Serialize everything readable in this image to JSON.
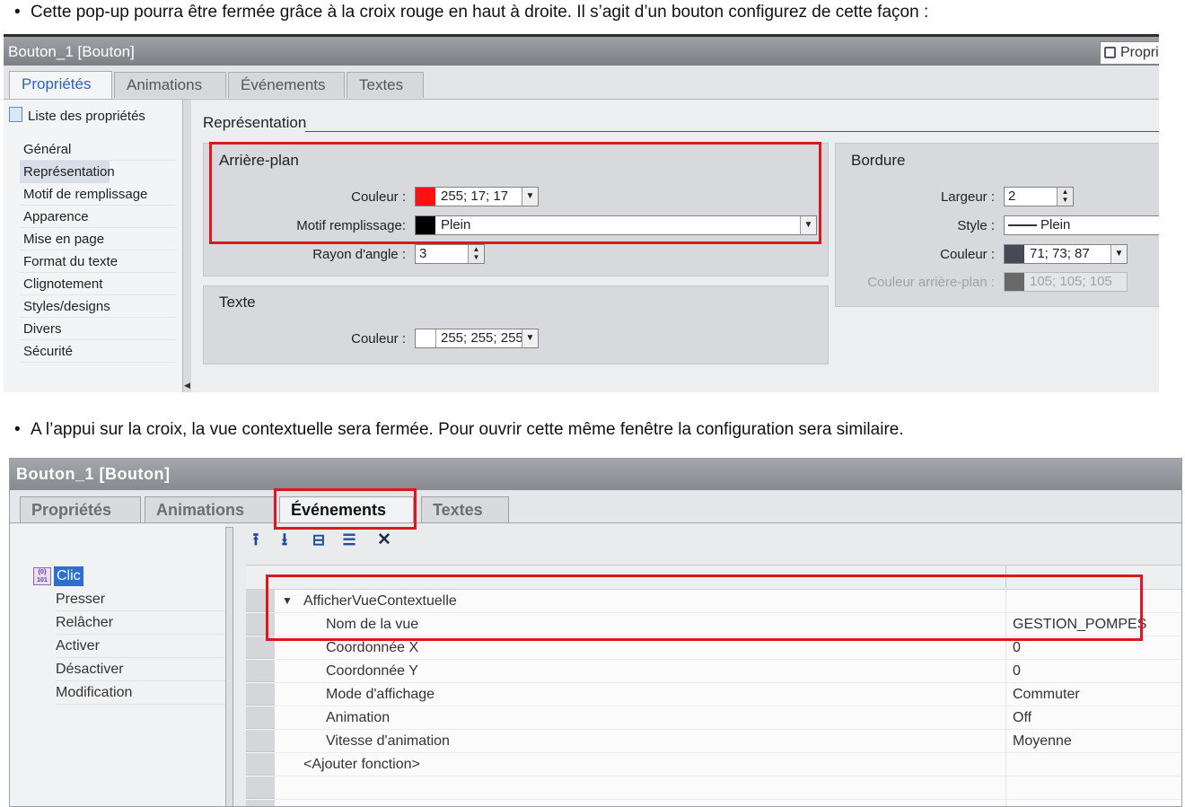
{
  "doc": {
    "bullet_char": "•",
    "bullet1": "Cette pop-up pourra être fermée grâce à la croix rouge en haut à droite. Il s’agit d’un bouton configurez de cette façon :",
    "bullet2": "A l’appui sur la croix, la vue contextuelle sera fermée. Pour ouvrir cette même fenêtre la configuration sera similaire."
  },
  "panel1": {
    "title": "Bouton_1 [Bouton]",
    "propri": "Propri",
    "tabs": [
      "Propriétés",
      "Animations",
      "Événements",
      "Textes"
    ],
    "active_tab": "Propriétés",
    "sidebar_header": "Liste des propriétés",
    "sidebar_items": [
      "Général",
      "Représentation",
      "Motif de remplissage",
      "Apparence",
      "Mise en page",
      "Format du texte",
      "Clignotement",
      "Styles/designs",
      "Divers",
      "Sécurité"
    ],
    "selected_item": "Représentation",
    "section": "Représentation",
    "arriere_plan": {
      "title": "Arrière-plan",
      "couleur_label": "Couleur :",
      "couleur_value": "255; 17; 17",
      "couleur_hex": "#ff1111",
      "motif_label": "Motif remplissage:",
      "motif_value": "Plein",
      "motif_hex": "#000000",
      "rayon_label": "Rayon d'angle :",
      "rayon_value": "3"
    },
    "texte": {
      "title": "Texte",
      "couleur_label": "Couleur :",
      "couleur_value": "255; 255; 255",
      "couleur_hex": "#ffffff"
    },
    "bordure": {
      "title": "Bordure",
      "largeur_label": "Largeur :",
      "largeur_value": "2",
      "style_label": "Style :",
      "style_value": "Plein",
      "couleur_label": "Couleur :",
      "couleur_value": "71; 73; 87",
      "couleur_hex": "#474957",
      "bg_label": "Couleur arrière-plan :",
      "bg_value": "105; 105; 105",
      "bg_hex": "#696969"
    },
    "highlight_color": "#e0161e"
  },
  "panel2": {
    "title": "Bouton_1 [Bouton]",
    "tabs": [
      "Propriétés",
      "Animations",
      "Événements",
      "Textes"
    ],
    "active_tab": "Événements",
    "events": {
      "selected": "Clic",
      "icon_text": "{0}\n101",
      "items": [
        "Presser",
        "Relâcher",
        "Activer",
        "Désactiver",
        "Modification"
      ]
    },
    "toolbar_icons": [
      "move-up-icon",
      "move-down-icon",
      "group-icon",
      "list-icon",
      "delete-icon"
    ],
    "function": {
      "name": "AfficherVueContextuelle",
      "params": [
        {
          "name": "Nom de la vue",
          "value": "GESTION_POMPES"
        },
        {
          "name": "Coordonnée X",
          "value": "0"
        },
        {
          "name": "Coordonnée Y",
          "value": "0"
        },
        {
          "name": "Mode d'affichage",
          "value": "Commuter"
        },
        {
          "name": "Animation",
          "value": "Off"
        },
        {
          "name": "Vitesse d'animation",
          "value": "Moyenne"
        }
      ],
      "add_label": "<Ajouter fonction>"
    }
  }
}
